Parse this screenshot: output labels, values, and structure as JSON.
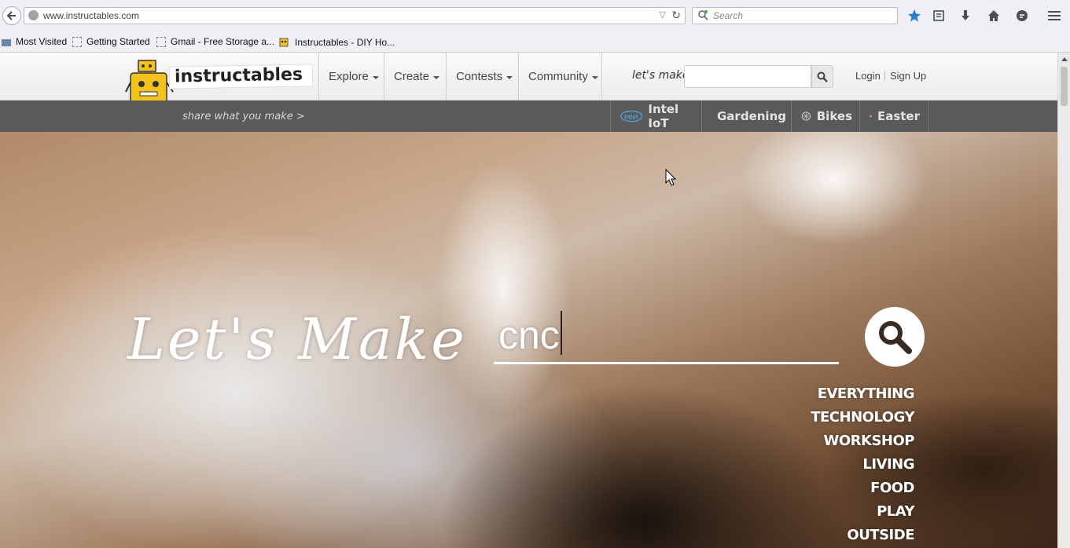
{
  "browser": {
    "url": "www.instructables.com",
    "search_placeholder": "Search",
    "bookmarks": [
      "Most Visited",
      "Getting Started",
      "Gmail - Free Storage a...",
      "Instructables - DIY Ho..."
    ]
  },
  "site": {
    "logo_text": "instructables",
    "tagline": "share what you make >",
    "nav": [
      "Explore",
      "Create",
      "Contests",
      "Community"
    ],
    "search_label": "let's make",
    "login": "Login",
    "signup": "Sign Up",
    "channels": [
      {
        "label": "Intel IoT",
        "icon": "intel-icon"
      },
      {
        "label": "Gardening",
        "icon": "leaf-icon"
      },
      {
        "label": "Bikes",
        "icon": "wheel-icon"
      },
      {
        "label": "Easter",
        "icon": "egg-icon"
      }
    ]
  },
  "hero": {
    "title": "Let's Make",
    "search_value": "cnc",
    "categories": [
      "EVERYTHING",
      "TECHNOLOGY",
      "WORKSHOP",
      "LIVING",
      "FOOD",
      "PLAY",
      "OUTSIDE"
    ]
  },
  "colors": {
    "subbar": "#5a5a5a",
    "accent_bookmark_star": "#2a7dd1",
    "robot_yellow": "#f3c21b"
  }
}
